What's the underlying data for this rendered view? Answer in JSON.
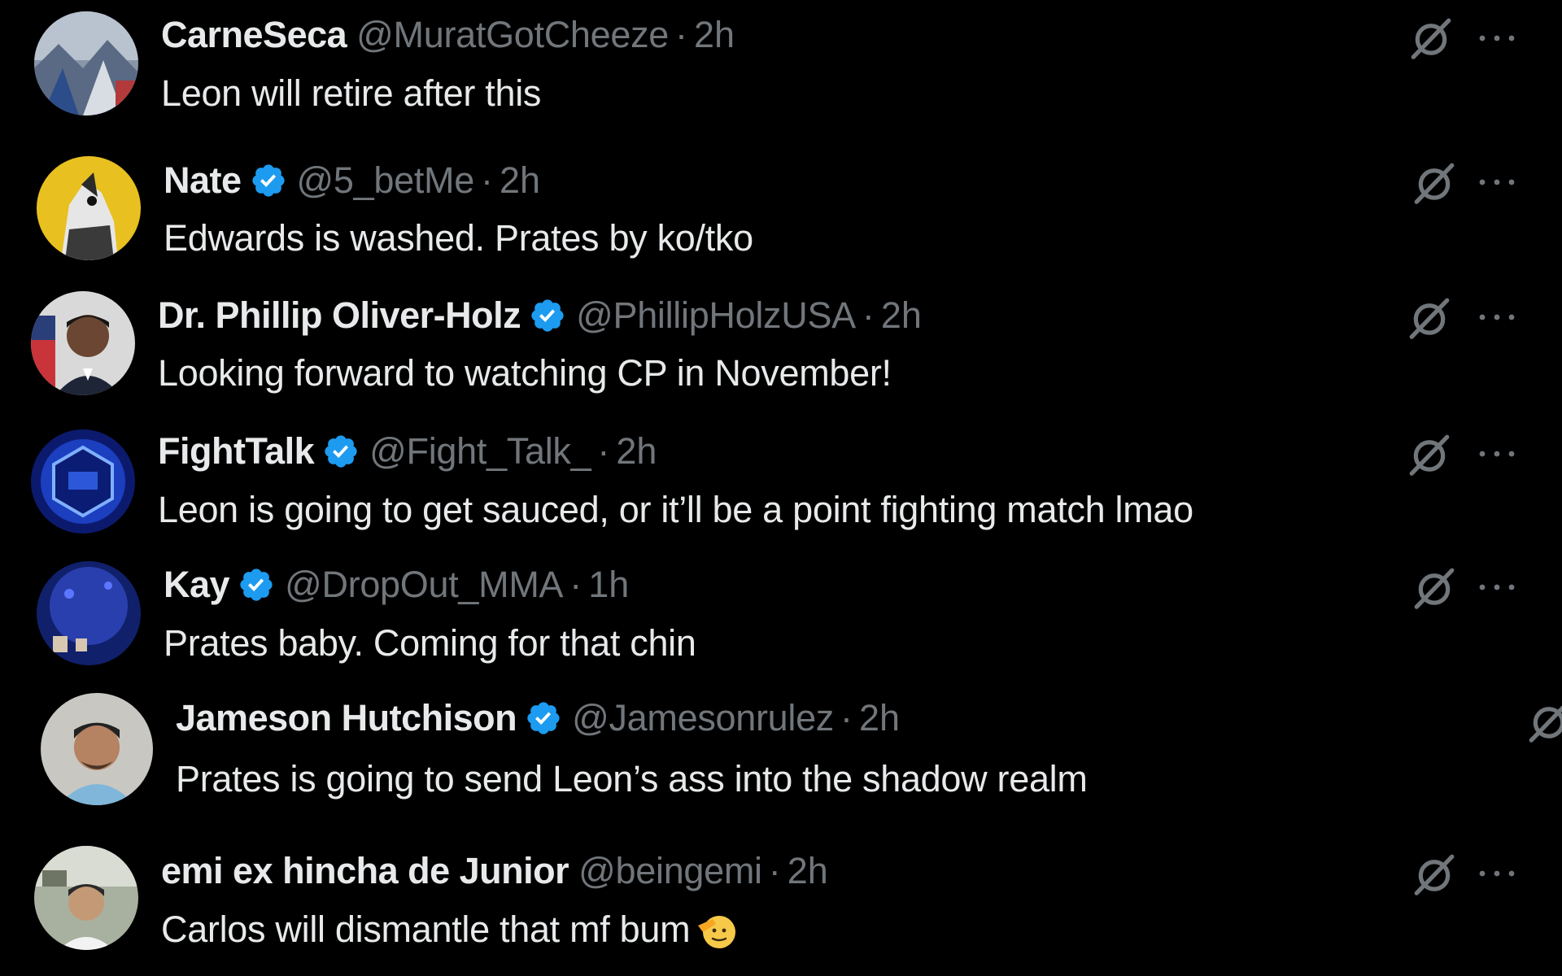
{
  "colors": {
    "background": "#000000",
    "primary_text": "#e7e9ea",
    "secondary_text": "#71767b",
    "verified_blue": "#1d9bf0"
  },
  "icons": {
    "verified": "verified-badge-icon",
    "grok": "grok-icon",
    "more": "more-options-icon"
  },
  "replies": [
    {
      "name": "CarneSeca",
      "verified": false,
      "handle": "@MuratGotCheeze",
      "separator": "·",
      "time": "2h",
      "text": "Leon will retire after this",
      "emoji": ""
    },
    {
      "name": "Nate",
      "verified": true,
      "handle": "@5_betMe",
      "separator": "·",
      "time": "2h",
      "text": "Edwards is washed. Prates by ko/tko",
      "emoji": ""
    },
    {
      "name": "Dr. Phillip Oliver-Holz",
      "verified": true,
      "handle": "@PhillipHolzUSA",
      "separator": "·",
      "time": "2h",
      "text": "Looking forward to watching CP in November!",
      "emoji": ""
    },
    {
      "name": "FightTalk",
      "verified": true,
      "handle": "@Fight_Talk_",
      "separator": "·",
      "time": "2h",
      "text": "Leon is going to get sauced, or it’ll be a point fighting match lmao",
      "emoji": ""
    },
    {
      "name": "Kay",
      "verified": true,
      "handle": "@DropOut_MMA",
      "separator": "·",
      "time": "1h",
      "text": "Prates baby. Coming for that chin",
      "emoji": ""
    },
    {
      "name": "Jameson Hutchison",
      "verified": true,
      "handle": "@Jamesonrulez",
      "separator": "·",
      "time": "2h",
      "text": "Prates is going to send Leon’s ass into the shadow realm",
      "emoji": ""
    },
    {
      "name": "emi ex hincha de Junior",
      "verified": false,
      "handle": "@beingemi",
      "separator": "·",
      "time": "2h",
      "text": "Carlos will dismantle that mf bum",
      "emoji": "saluting-face"
    }
  ]
}
